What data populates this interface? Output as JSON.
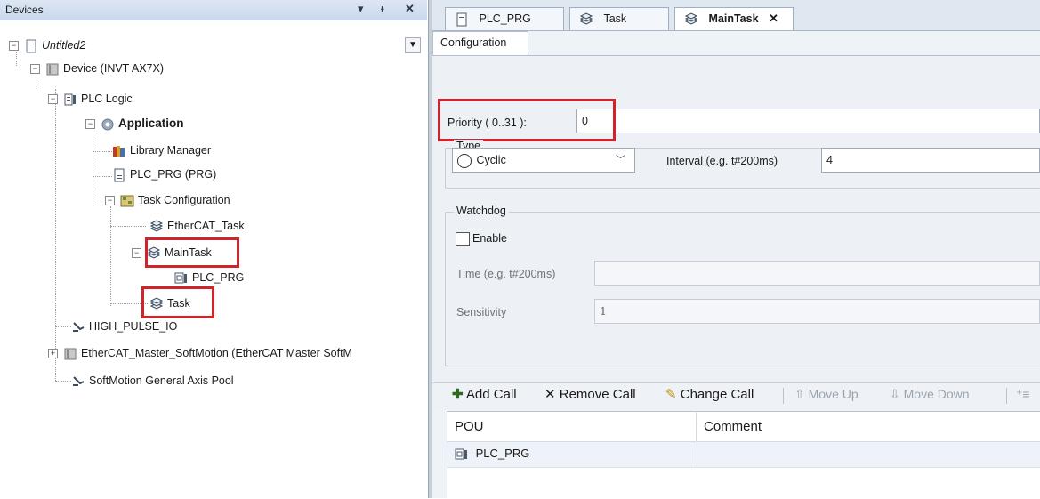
{
  "devices_pane": {
    "title": "Devices",
    "header_buttons": {
      "dropdown": "▾",
      "pin": "ᵼ",
      "close": "✕"
    },
    "tree": {
      "project": "Untitled2",
      "device": "Device (INVT AX7X)",
      "plc_logic": "PLC Logic",
      "application": "Application",
      "library_manager": "Library Manager",
      "plc_prg": "PLC_PRG (PRG)",
      "task_configuration": "Task Configuration",
      "ethercat_task": "EtherCAT_Task",
      "main_task": "MainTask",
      "main_task_call": "PLC_PRG",
      "task": "Task",
      "high_pulse_io": "HIGH_PULSE_IO",
      "ethercat_master": "EtherCAT_Master_SoftMotion (EtherCAT Master SoftM",
      "softmotion_pool": "SoftMotion General Axis Pool"
    }
  },
  "tabs": [
    {
      "label": "PLC_PRG",
      "icon": "pou-icon"
    },
    {
      "label": "Task",
      "icon": "task-icon"
    },
    {
      "label": "MainTask",
      "icon": "task-icon",
      "active": true
    }
  ],
  "tab_close": "✕",
  "subtab": "Configuration",
  "config": {
    "priority_label": "Priority ( 0..31 ):",
    "priority_value": "0",
    "type_group": "Type",
    "type_value": "Cyclic",
    "interval_label": "Interval (e.g. t#200ms)",
    "interval_value": "4",
    "watchdog_group": "Watchdog",
    "enable_label": "Enable",
    "enable_checked": false,
    "time_label": "Time (e.g. t#200ms)",
    "time_value": "",
    "sensitivity_label": "Sensitivity",
    "sensitivity_value": "1"
  },
  "call_toolbar": {
    "add_call": "Add Call",
    "remove_call": "Remove Call",
    "change_call": "Change Call",
    "move_up": "Move Up",
    "move_down": "Move Down"
  },
  "call_table": {
    "headers": [
      "POU",
      "Comment"
    ],
    "rows": [
      {
        "pou": "PLC_PRG",
        "comment": ""
      }
    ]
  },
  "colors": {
    "highlight_red": "#d0232c",
    "header_blue": "#c9d8ec"
  }
}
